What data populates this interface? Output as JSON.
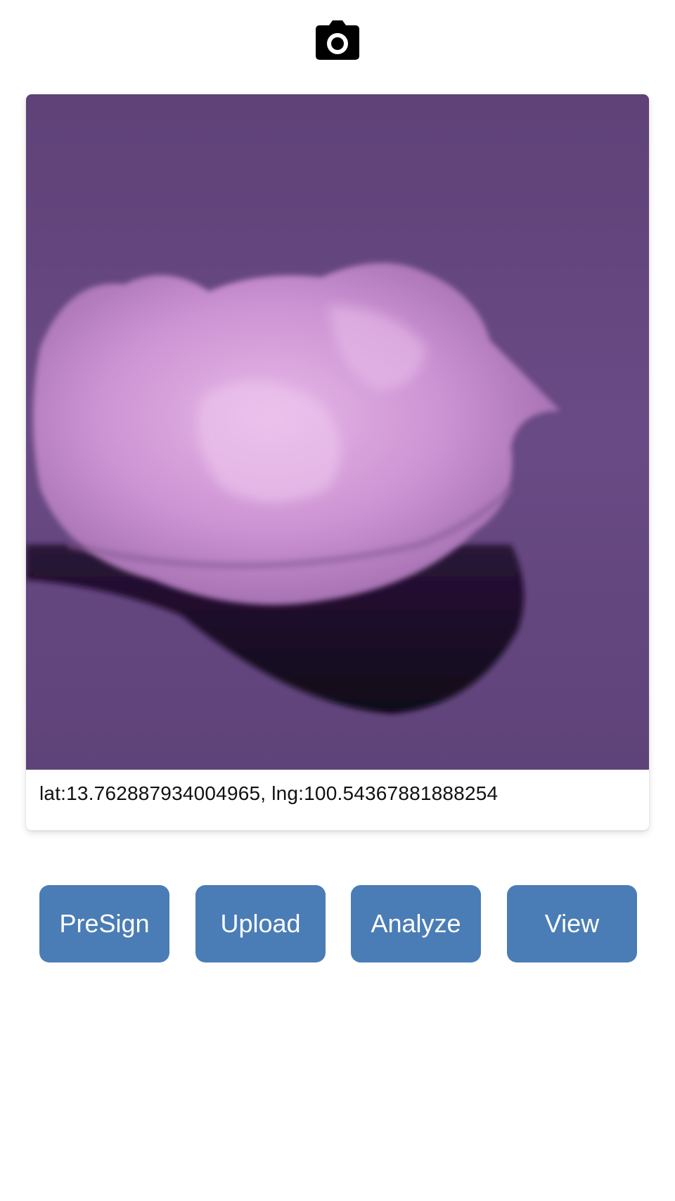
{
  "header": {
    "icon": "camera-icon"
  },
  "photo": {
    "subject": "ice-cream-scoop-photo"
  },
  "location": {
    "text": "lat:13.762887934004965, lng:100.54367881888254"
  },
  "actions": {
    "presign_label": "PreSign",
    "upload_label": "Upload",
    "analyze_label": "Analyze",
    "view_label": "View"
  },
  "colors": {
    "button_bg": "#4a7db6",
    "button_text": "#ffffff",
    "photo_bg": "#66477f",
    "ice_cream": "#c98fcf"
  }
}
